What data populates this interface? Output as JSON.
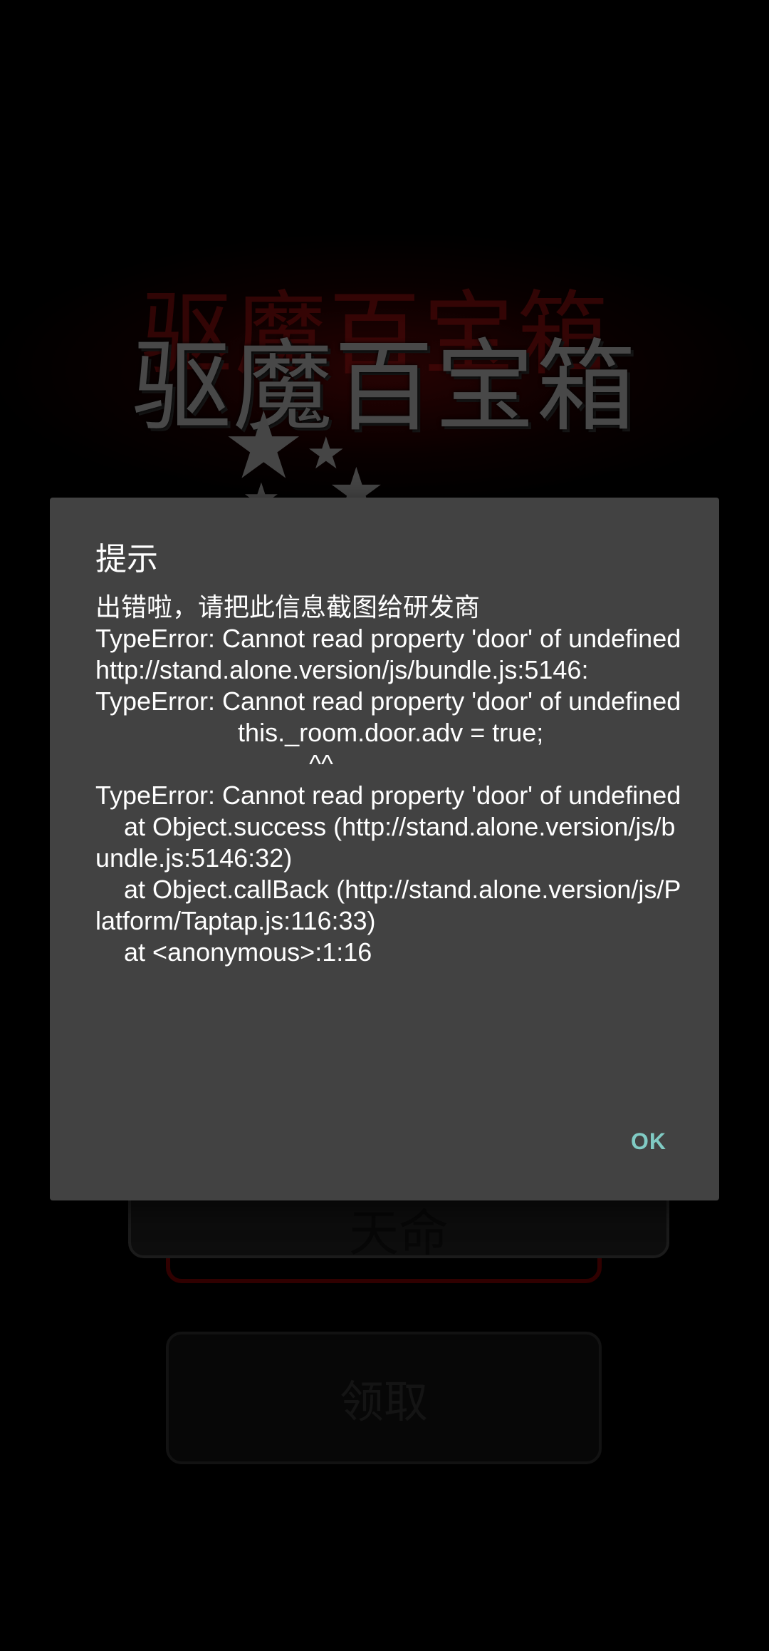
{
  "background": {
    "game_title": "驱魔百宝箱",
    "main_button_label": "天命",
    "claim_button_label": "领取"
  },
  "dialog": {
    "title": "提示",
    "message": "出错啦，请把此信息截图给研发商\nTypeError: Cannot read property 'door' of undefined\nhttp://stand.alone.version/js/bundle.js:5146:\nTypeError: Cannot read property 'door' of undefined\n                    this._room.door.adv = true;\n                              ^^\nTypeError: Cannot read property 'door' of undefined\n    at Object.success (http://stand.alone.version/js/bundle.js:5146:32)\n    at Object.callBack (http://stand.alone.version/js/Platform/Taptap.js:116:33)\n    at <anonymous>:1:16",
    "ok_label": "OK"
  },
  "colors": {
    "dialog_bg": "#424242",
    "accent": "#80cbc4",
    "background": "#000000"
  }
}
